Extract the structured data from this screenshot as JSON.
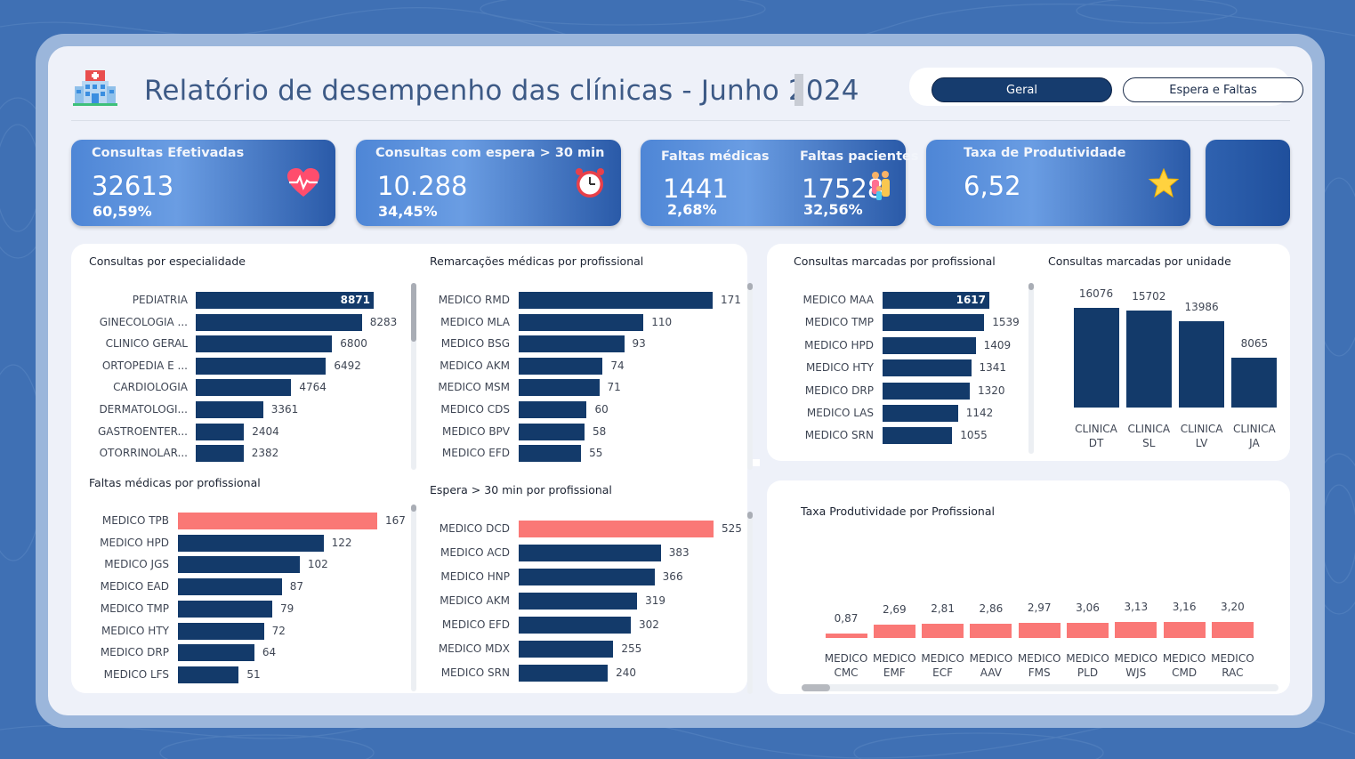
{
  "header": {
    "title": "Relatório de desempenho das clínicas - Junho 2024",
    "icon": "hospital-icon"
  },
  "nav": {
    "geral": "Geral",
    "espera_faltas": "Espera e Faltas",
    "active": "Geral"
  },
  "kpis": {
    "efetivadas": {
      "label": "Consultas Efetivadas",
      "value": "32613",
      "pct": "60,59%",
      "icon": "heart-pulse-icon"
    },
    "espera": {
      "label": "Consultas com espera > 30 min",
      "value": "10.288",
      "pct": "34,45%",
      "icon": "alarm-clock-icon"
    },
    "faltas_medicas": {
      "label": "Faltas médicas",
      "value": "1441",
      "pct": "2,68%"
    },
    "faltas_pacientes": {
      "label": "Faltas pacientes",
      "value": "17528",
      "pct": "32,56%",
      "icon": "family-icon"
    },
    "produtividade": {
      "label": "Taxa de Produtividade",
      "value": "6,52",
      "icon": "star-icon"
    }
  },
  "colors": {
    "bar_primary": "#133a6a",
    "bar_highlight": "#fa7876",
    "background": "#3f70b4"
  },
  "chart_data": [
    {
      "type": "bar",
      "orientation": "horizontal",
      "title": "Consultas por especialidade",
      "categories": [
        "PEDIATRIA",
        "GINECOLOGIA ...",
        "CLINICO GERAL",
        "ORTOPEDIA E ...",
        "CARDIOLOGIA",
        "DERMATOLOGI...",
        "GASTROENTER...",
        "OTORRINOLAR..."
      ],
      "values": [
        8871,
        8283,
        6800,
        6492,
        4764,
        3361,
        2404,
        2382
      ]
    },
    {
      "type": "bar",
      "orientation": "horizontal",
      "title": "Remarcações médicas por profissional",
      "categories": [
        "MEDICO RMD",
        "MEDICO MLA",
        "MEDICO BSG",
        "MEDICO AKM",
        "MEDICO MSM",
        "MEDICO CDS",
        "MEDICO BPV",
        "MEDICO EFD"
      ],
      "values": [
        171,
        110,
        93,
        74,
        71,
        60,
        58,
        55
      ]
    },
    {
      "type": "bar",
      "orientation": "horizontal",
      "title": "Faltas médicas por profissional",
      "categories": [
        "MEDICO TPB",
        "MEDICO HPD",
        "MEDICO JGS",
        "MEDICO EAD",
        "MEDICO TMP",
        "MEDICO HTY",
        "MEDICO DRP",
        "MEDICO LFS"
      ],
      "values": [
        167,
        122,
        102,
        87,
        79,
        72,
        64,
        51
      ],
      "highlight_index": 0
    },
    {
      "type": "bar",
      "orientation": "horizontal",
      "title": "Espera > 30 min por profissional",
      "categories": [
        "MEDICO DCD",
        "MEDICO ACD",
        "MEDICO HNP",
        "MEDICO AKM",
        "MEDICO EFD",
        "MEDICO MDX",
        "MEDICO SRN"
      ],
      "values": [
        525,
        383,
        366,
        319,
        302,
        255,
        240
      ],
      "highlight_index": 0
    },
    {
      "type": "bar",
      "orientation": "horizontal",
      "title": "Consultas marcadas por profissional",
      "categories": [
        "MEDICO MAA",
        "MEDICO TMP",
        "MEDICO HPD",
        "MEDICO HTY",
        "MEDICO DRP",
        "MEDICO LAS",
        "MEDICO SRN"
      ],
      "values": [
        1617,
        1539,
        1409,
        1341,
        1320,
        1142,
        1055
      ]
    },
    {
      "type": "bar",
      "orientation": "vertical",
      "title": "Consultas marcadas por unidade",
      "categories": [
        "CLINICA DT",
        "CLINICA SL",
        "CLINICA LV",
        "CLINICA JA"
      ],
      "values": [
        16076,
        15702,
        13986,
        8065
      ]
    },
    {
      "type": "bar",
      "orientation": "vertical",
      "title": "Taxa Produtividade por Profissional",
      "categories": [
        "MEDICO CMC",
        "MEDICO EMF",
        "MEDICO ECF",
        "MEDICO AAV",
        "MEDICO FMS",
        "MEDICO PLD",
        "MEDICO WJS",
        "MEDICO CMD",
        "MEDICO RAC"
      ],
      "values": [
        0.87,
        2.69,
        2.81,
        2.86,
        2.97,
        3.06,
        3.13,
        3.16,
        3.2
      ],
      "value_labels": [
        "0,87",
        "2,69",
        "2,81",
        "2,86",
        "2,97",
        "3,06",
        "3,13",
        "3,16",
        "3,20"
      ]
    }
  ]
}
